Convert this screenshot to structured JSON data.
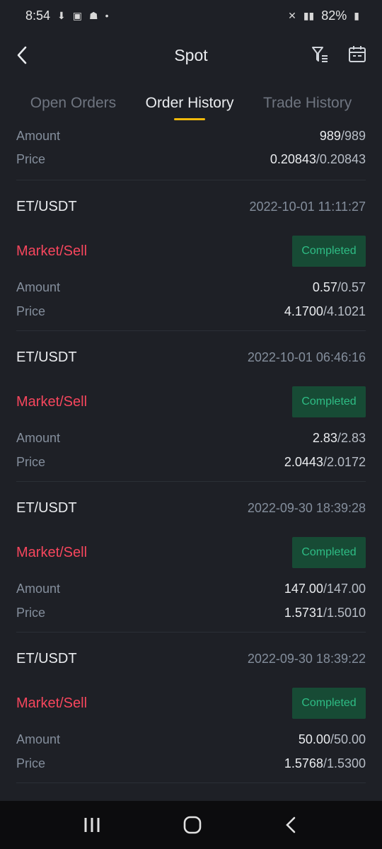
{
  "status_bar": {
    "time": "8:54",
    "battery": "82%"
  },
  "header": {
    "title": "Spot"
  },
  "tabs": [
    {
      "label": "Open Orders",
      "active": false
    },
    {
      "label": "Order History",
      "active": true
    },
    {
      "label": "Trade History",
      "active": false
    }
  ],
  "partial_order": {
    "amount_label": "Amount",
    "amount_filled": "989",
    "amount_total": "/989",
    "price_label": "Price",
    "price_filled": "0.20843",
    "price_avg": "/0.20843"
  },
  "orders": [
    {
      "pair": "ET/USDT",
      "datetime": "2022-10-01 11:11:27",
      "side": "Market/Sell",
      "status": "Completed",
      "amount_label": "Amount",
      "amount_filled": "0.57",
      "amount_total": "/0.57",
      "price_label": "Price",
      "price_filled": "4.1700",
      "price_avg": "/4.1021"
    },
    {
      "pair": "ET/USDT",
      "datetime": "2022-10-01 06:46:16",
      "side": "Market/Sell",
      "status": "Completed",
      "amount_label": "Amount",
      "amount_filled": "2.83",
      "amount_total": "/2.83",
      "price_label": "Price",
      "price_filled": "2.0443",
      "price_avg": "/2.0172"
    },
    {
      "pair": "ET/USDT",
      "datetime": "2022-09-30 18:39:28",
      "side": "Market/Sell",
      "status": "Completed",
      "amount_label": "Amount",
      "amount_filled": "147.00",
      "amount_total": "/147.00",
      "price_label": "Price",
      "price_filled": "1.5731",
      "price_avg": "/1.5010"
    },
    {
      "pair": "ET/USDT",
      "datetime": "2022-09-30 18:39:22",
      "side": "Market/Sell",
      "status": "Completed",
      "amount_label": "Amount",
      "amount_filled": "50.00",
      "amount_total": "/50.00",
      "price_label": "Price",
      "price_filled": "1.5768",
      "price_avg": "/1.5300"
    }
  ],
  "colors": {
    "accent": "#f0b90b",
    "sell": "#f6465d",
    "completed_text": "#2ebd85",
    "completed_bg": "#174b35"
  },
  "icons": [
    "back-arrow-icon",
    "filter-icon",
    "calendar-icon",
    "recents-icon",
    "home-icon",
    "nav-back-icon"
  ]
}
